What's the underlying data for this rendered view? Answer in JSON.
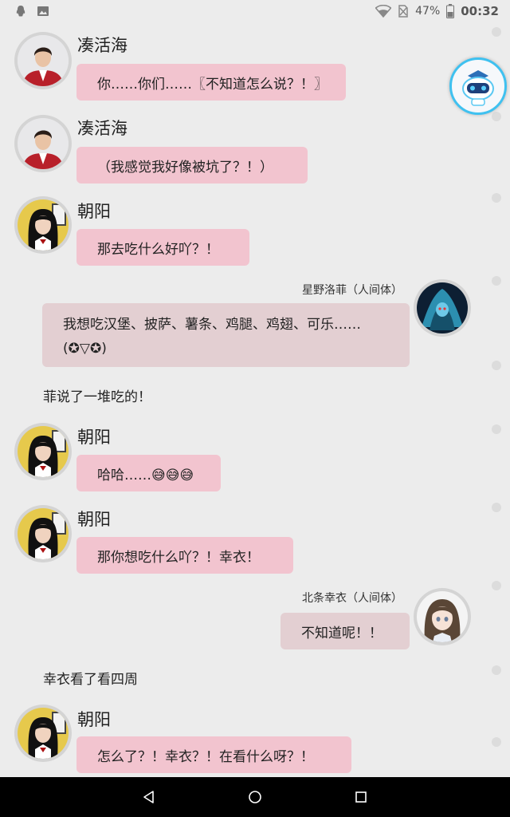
{
  "status": {
    "battery": "47%",
    "time": "00:32",
    "icons": [
      "qq-icon",
      "gallery-icon",
      "wifi-icon",
      "no-sim-icon",
      "battery-icon"
    ]
  },
  "messages": [
    {
      "sender": "凑活海",
      "text": "你……你们……〖不知道怎么说？！〗"
    },
    {
      "sender": "凑活海",
      "text": "（我感觉我好像被坑了？！）"
    },
    {
      "sender": "朝阳",
      "text": "那去吃什么好吖？！"
    },
    {
      "sender": "星野洛菲（人间体）",
      "text": "我想吃汉堡、披萨、薯条、鸡腿、鸡翅、可乐……(✪▽✪)"
    },
    {
      "narration": "菲说了一堆吃的！"
    },
    {
      "sender": "朝阳",
      "text": "哈哈……😅😅😅"
    },
    {
      "sender": "朝阳",
      "text": "那你想吃什么吖？！幸衣！"
    },
    {
      "sender": "北条幸衣（人间体）",
      "text": "不知道呢！！"
    },
    {
      "narration": "幸衣看了看四周"
    },
    {
      "sender": "朝阳",
      "text": "怎么了？！幸衣？！在看什么呀？！"
    }
  ],
  "colors": {
    "background": "#ececec",
    "bubble_left": "#f2c4cf",
    "bubble_right": "#e3cfd2",
    "nav_bar": "#000000"
  },
  "nav": [
    "back-icon",
    "home-icon",
    "recents-icon"
  ]
}
